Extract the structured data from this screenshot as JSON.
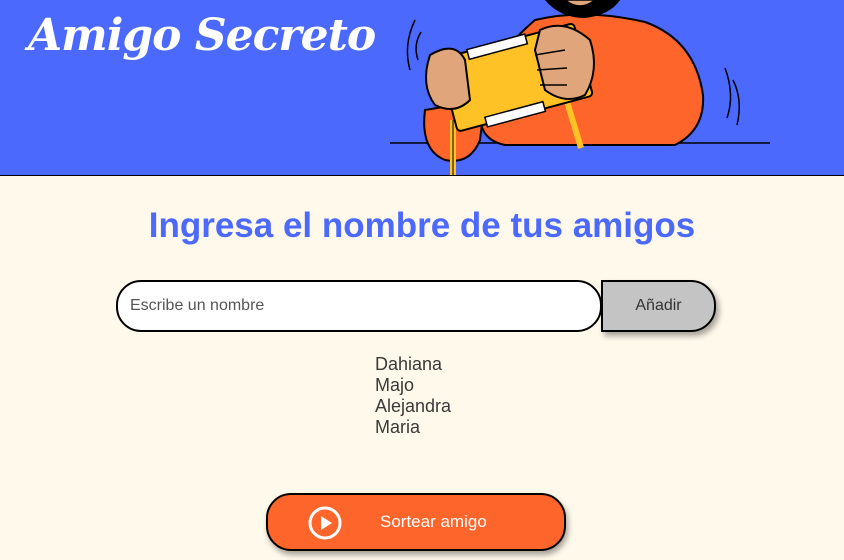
{
  "header": {
    "title": "Amigo Secreto",
    "illustration": "person-playing-handheld-game"
  },
  "main": {
    "heading": "Ingresa el nombre de tus amigos",
    "name_input": {
      "placeholder": "Escribe un nombre",
      "value": ""
    },
    "add_button_label": "Añadir",
    "friends": [
      "Dahiana",
      "Majo",
      "Alejandra",
      "Maria"
    ],
    "draw_button": {
      "label": "Sortear amigo",
      "icon": "play-circle-icon"
    }
  },
  "colors": {
    "header_bg": "#4B69FD",
    "page_bg": "#FFF9EB",
    "accent": "#FE652B",
    "heading": "#4B69FD",
    "add_button_bg": "#C4C4C4"
  }
}
